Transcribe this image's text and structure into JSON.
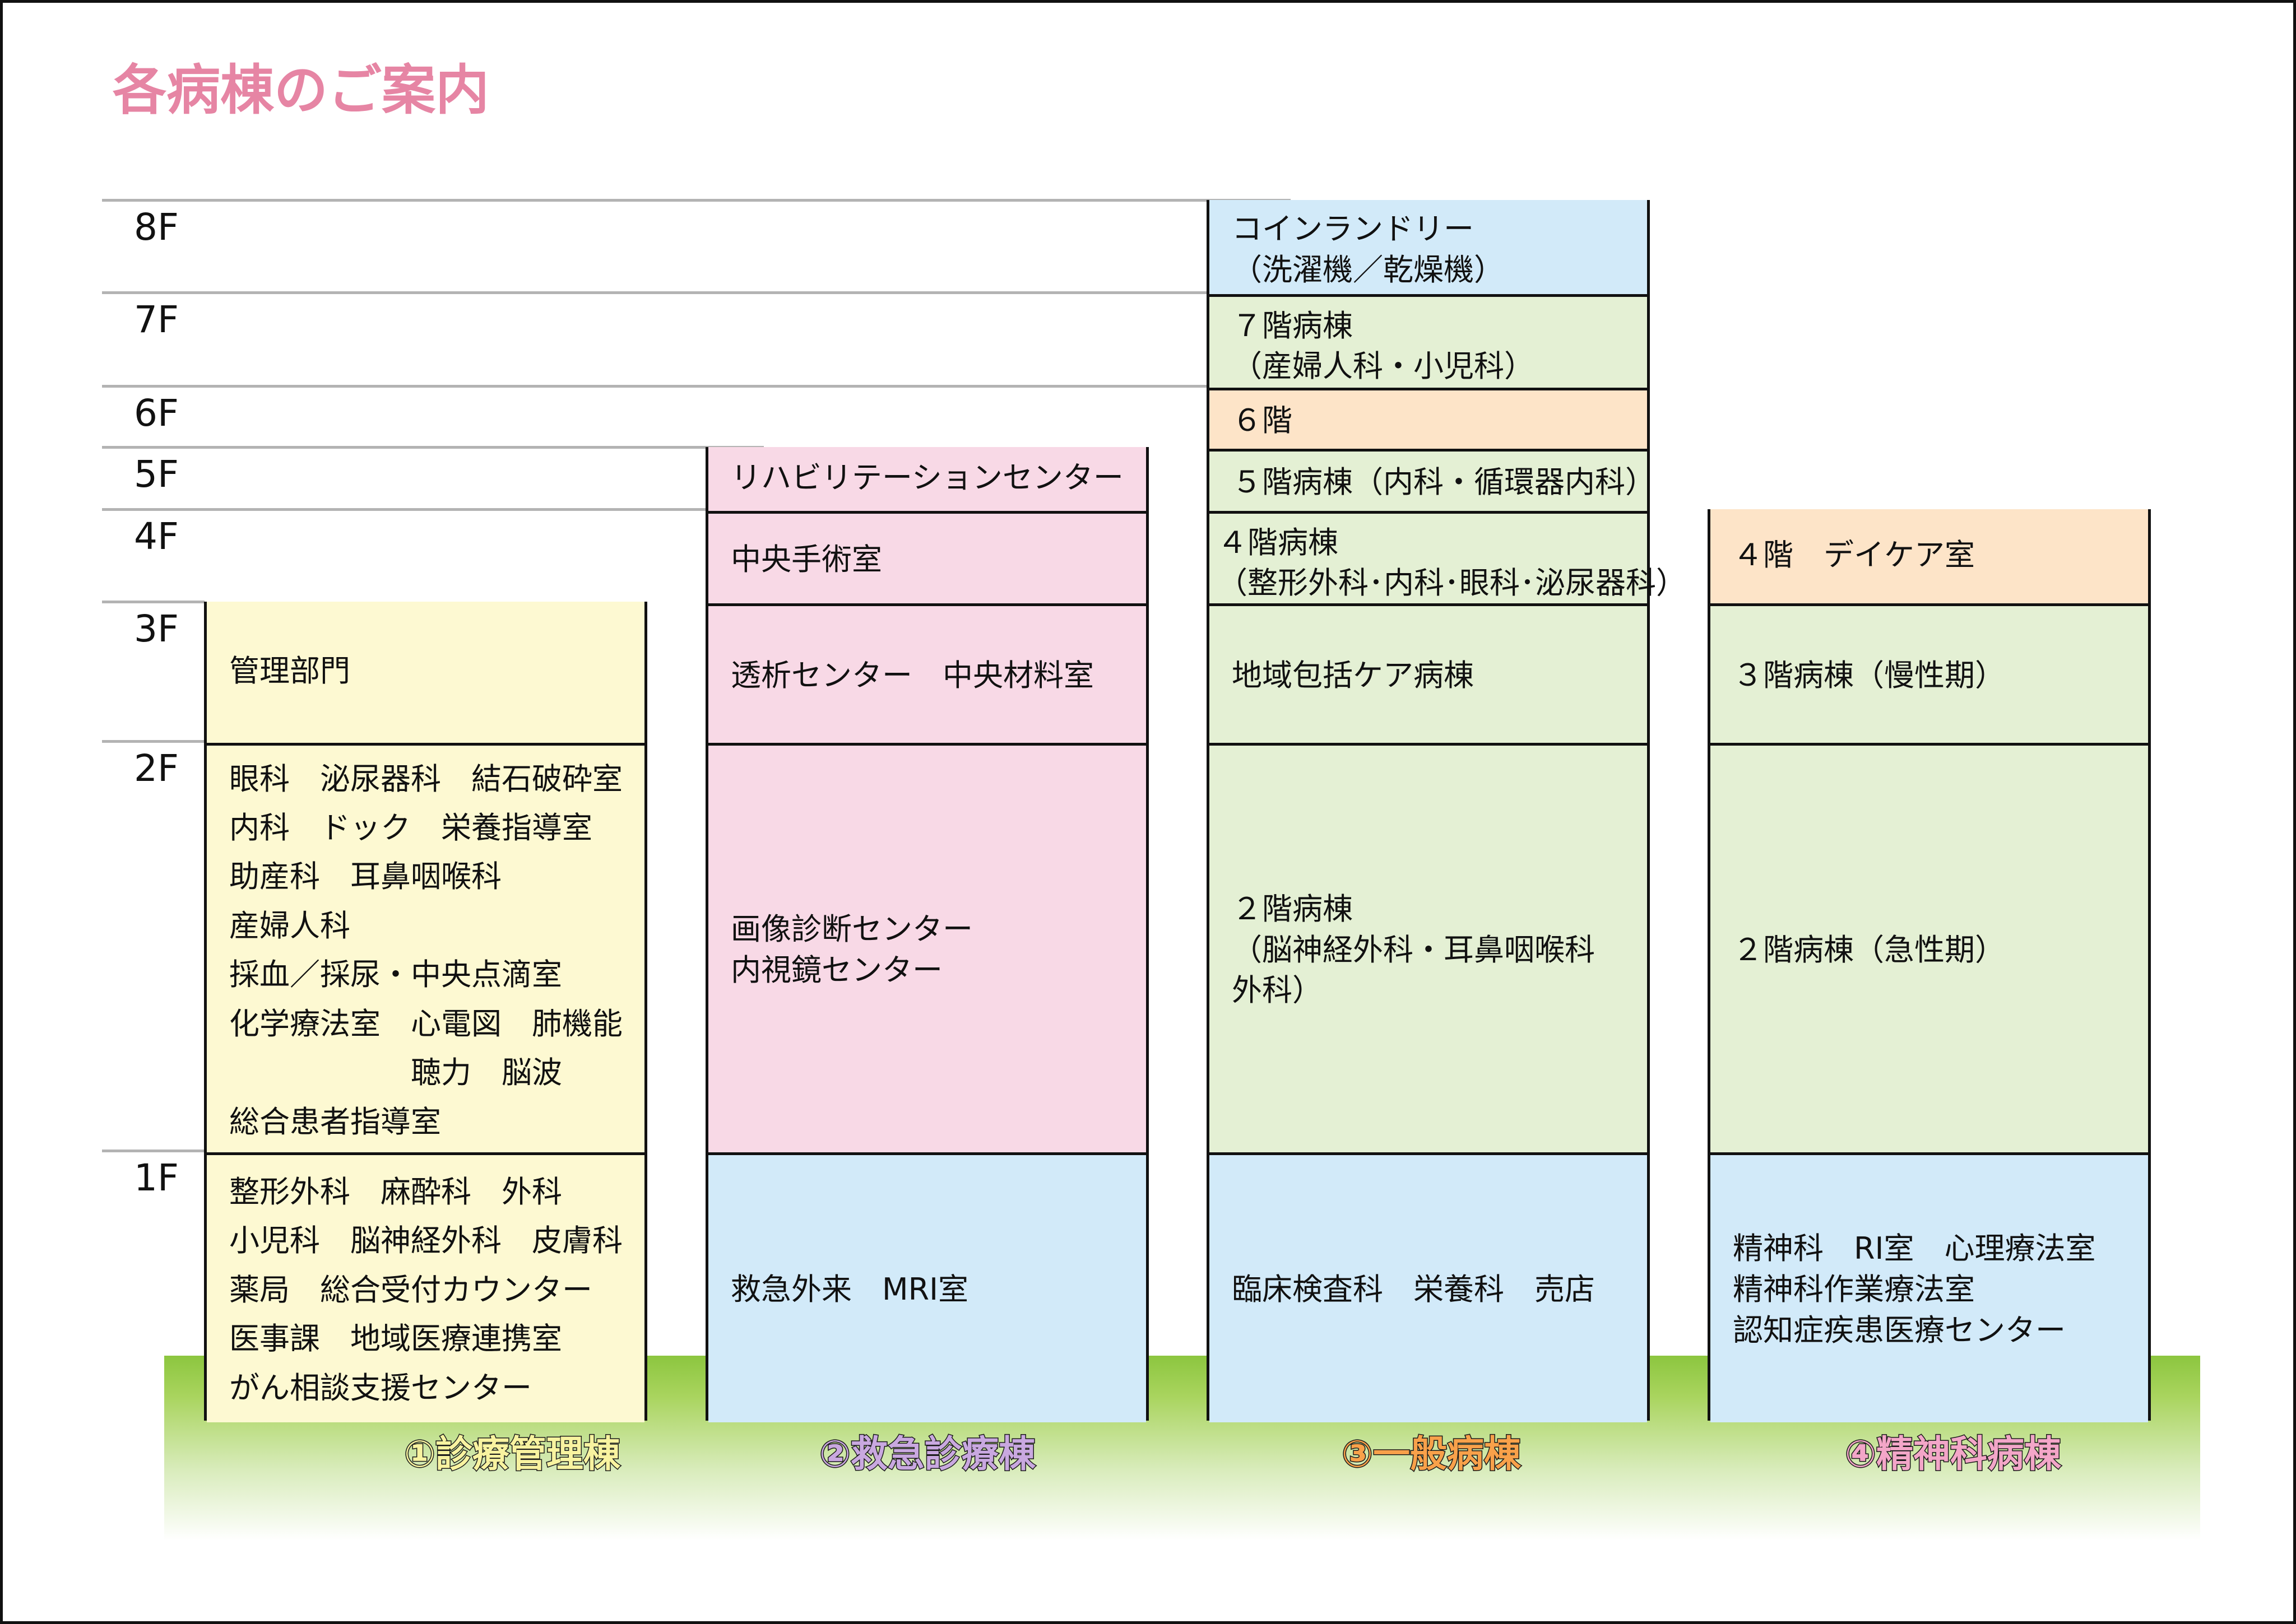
{
  "title": "各病棟のご案内",
  "floors": [
    "8F",
    "7F",
    "6F",
    "5F",
    "4F",
    "3F",
    "2F",
    "1F"
  ],
  "colors": {
    "title": "#e685a4",
    "yellow": "#fdf9d2",
    "pink": "#f8d9e6",
    "blue": "#d2eaf9",
    "green": "#e4f0d4",
    "orange": "#fde4c8",
    "ground": "#8cc63f"
  },
  "buildings": [
    {
      "label_number": "①",
      "label_name": "診療管理棟",
      "label_color": "#f8f3a0",
      "cells": [
        {
          "floor": "3F",
          "lines": [
            "管理部門"
          ]
        },
        {
          "floor": "2F",
          "lines": [
            "眼科　泌尿器科　結石破砕室",
            "内科　ドック　栄養指導室",
            "助産科　耳鼻咽喉科",
            "産婦人科",
            "採血／採尿・中央点滴室",
            "化学療法室　心電図　肺機能",
            "　　　　　　聴力　脳波",
            "総合患者指導室"
          ]
        },
        {
          "floor": "1F",
          "lines": [
            "整形外科　麻酔科　外科",
            "小児科　脳神経外科　皮膚科",
            "薬局　総合受付カウンター",
            "医事課　地域医療連携室",
            "がん相談支援センター"
          ]
        }
      ]
    },
    {
      "label_number": "②",
      "label_name": "救急診療棟",
      "label_color": "#c9a8e0",
      "cells": [
        {
          "floor": "5F",
          "lines": [
            "リハビリテーションセンター"
          ]
        },
        {
          "floor": "4F",
          "lines": [
            "中央手術室"
          ]
        },
        {
          "floor": "3F",
          "lines": [
            "透析センター　中央材料室"
          ]
        },
        {
          "floor": "2F",
          "lines": [
            "画像診断センター",
            "内視鏡センター"
          ]
        },
        {
          "floor": "1F",
          "lines": [
            "救急外来　MRI室"
          ]
        }
      ]
    },
    {
      "label_number": "③",
      "label_name": "一般病棟",
      "label_color": "#f8a14a",
      "cells": [
        {
          "floor": "8F",
          "lines": [
            "コインランドリー",
            "（洗濯機／乾燥機）"
          ]
        },
        {
          "floor": "7F",
          "lines": [
            "７階病棟",
            "（産婦人科・小児科）"
          ]
        },
        {
          "floor": "6F",
          "lines": [
            "６階"
          ]
        },
        {
          "floor": "5F",
          "lines": [
            "５階病棟（内科・循環器内科）"
          ]
        },
        {
          "floor": "4F",
          "lines": [
            "４階病棟",
            "（整形外科･内科･眼科･泌尿器科）"
          ]
        },
        {
          "floor": "3F",
          "lines": [
            "地域包括ケア病棟"
          ]
        },
        {
          "floor": "2F",
          "lines": [
            "２階病棟",
            "（脳神経外科・耳鼻咽喉科",
            "外科）"
          ]
        },
        {
          "floor": "1F",
          "lines": [
            "臨床検査科　栄養科　売店"
          ]
        }
      ]
    },
    {
      "label_number": "④",
      "label_name": "精神科病棟",
      "label_color": "#f3a6c8",
      "cells": [
        {
          "floor": "4F",
          "lines": [
            "４階　デイケア室"
          ]
        },
        {
          "floor": "3F",
          "lines": [
            "３階病棟（慢性期）"
          ]
        },
        {
          "floor": "2F",
          "lines": [
            "２階病棟（急性期）"
          ]
        },
        {
          "floor": "1F",
          "lines": [
            "精神科　RI室　心理療法室",
            "精神科作業療法室",
            "認知症疾患医療センター"
          ]
        }
      ]
    }
  ]
}
